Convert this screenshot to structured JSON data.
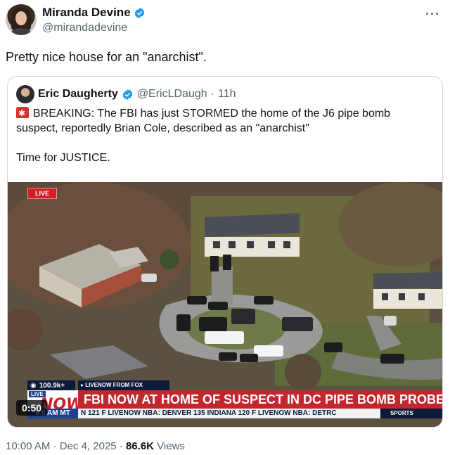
{
  "author": {
    "name": "Miranda Devine",
    "handle": "@mirandadevine",
    "verified": true
  },
  "more_icon": "more-horizontal-icon",
  "tweet": {
    "text": "Pretty nice house for an \"anarchist\"."
  },
  "quoted_tweet": {
    "name": "Eric Daugherty",
    "handle": "@EricLDaugh",
    "separator": "·",
    "age": "11h",
    "line1": "BREAKING: The FBI has just STORMED the home of the J6 pipe bomb suspect, reportedly Brian Cole, described as an \"anarchist\"",
    "line2": "Time for JUSTICE.",
    "video": {
      "live_chip": "LIVE",
      "viewers": "100.9k+",
      "from_label": "▸ LIVENOW FROM FOX",
      "logo_top": "LIVE",
      "logo_main": "NOW",
      "headline": "FBI NOW AT HOME OF SUSPECT IN DC PIPE BOMB PROBE",
      "ticker_time": "8:0 AM MT",
      "ticker_text": "N 121 F  LIVENOW  NBA: DENVER 135 INDIANA 120 F  LIVENOW  NBA: DETRC",
      "ticker_sports": "SPORTS",
      "timecode": "0:50"
    }
  },
  "meta": {
    "time": "10:00 AM",
    "dot": "·",
    "date": "Dec 4, 2025",
    "views_count": "86.6K",
    "views_label": "Views"
  },
  "colors": {
    "verified": "#1d9bf0",
    "headline_red": "#c1272d",
    "ticker_navy": "#0c1a3a"
  }
}
